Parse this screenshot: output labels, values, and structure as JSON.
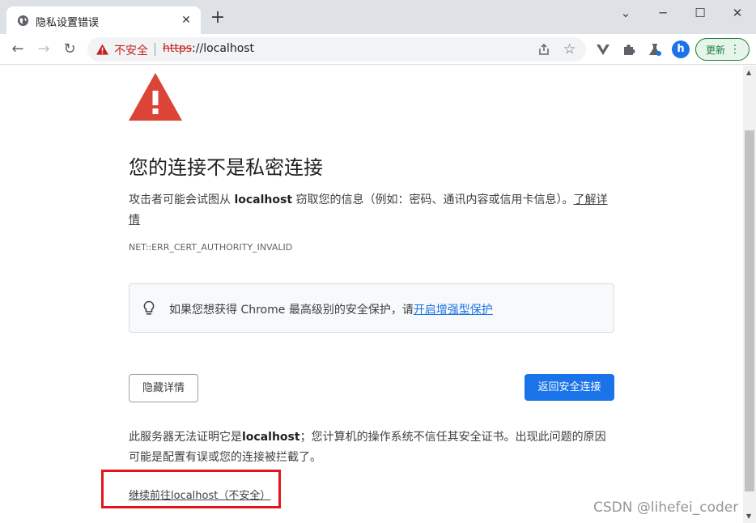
{
  "tab": {
    "title": "隐私设置错误",
    "favicon": "globe-icon",
    "close": "✕",
    "new_tab": "+"
  },
  "window_controls": {
    "minimize": "chevron-down-icon",
    "min_glyph": "─",
    "max_glyph": "☐",
    "close_glyph": "✕",
    "tab_search_glyph": "⌄"
  },
  "toolbar": {
    "back": "←",
    "forward": "→",
    "reload": "↻",
    "insecure_label": "不安全",
    "url_scheme": "https",
    "url_rest": "://localhost",
    "star": "☆",
    "avatar_initial": "h",
    "update_label": "更新",
    "menu_dots": "⋮"
  },
  "page": {
    "title": "您的连接不是私密连接",
    "desc_prefix": "攻击者可能会试图从 ",
    "desc_host": "localhost",
    "desc_suffix": " 窃取您的信息（例如：密码、通讯内容或信用卡信息）。",
    "learn_more": "了解详情",
    "error_code": "NET::ERR_CERT_AUTHORITY_INVALID",
    "promo_text": "如果您想获得 Chrome 最高级别的安全保护，请",
    "promo_link": "开启增强型保护",
    "hide_details": "隐藏详情",
    "back_to_safety": "返回安全连接",
    "detail_prefix": "此服务器无法证明它是",
    "detail_host": "localhost",
    "detail_suffix": "；您计算机的操作系统不信任其安全证书。出现此问题的原因可能是配置有误或您的连接被拦截了。",
    "proceed_link": "继续前往localhost（不安全）"
  },
  "scrollbar": {
    "up": "▲",
    "down": "▼"
  },
  "watermark": "CSDN @lihefei_coder",
  "colors": {
    "accent": "#1a73e8",
    "danger": "#db4437",
    "insecure": "#c5221f",
    "update": "#188038",
    "highlight": "#e3161f"
  }
}
